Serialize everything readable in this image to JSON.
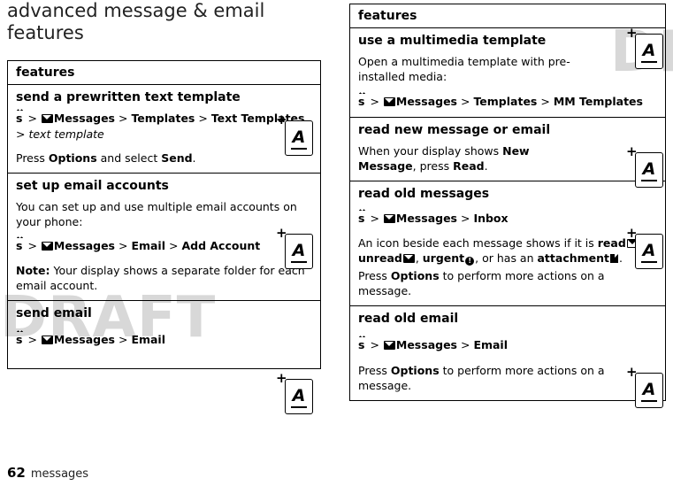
{
  "document": {
    "chapter_title": "advanced message & email features",
    "watermark": "DRAFT",
    "footer": {
      "page_number": "62",
      "section": "messages"
    }
  },
  "left_table": {
    "header": "features",
    "rows": [
      {
        "name": "send a prewritten text template",
        "nav_prefix": "s",
        "nav_path": " > ✉ Messages > Templates > Text Templates > text template",
        "nav_parts": [
          "Messages",
          "Templates",
          "Text Templates"
        ],
        "nav_italic": "text template",
        "note_pre": "Press ",
        "note_bold1": "Options",
        "note_mid": " and select ",
        "note_bold2": "Send",
        "note_end": "."
      },
      {
        "name": "set up email accounts",
        "body": "You can set up and use multiple email accounts on your phone:",
        "nav_parts": [
          "Messages",
          "Email",
          "Add Account"
        ],
        "note_label": "Note:",
        "note_text": " Your display shows a separate folder for each email account."
      },
      {
        "name": "send email",
        "nav_parts": [
          "Messages",
          "Email"
        ]
      }
    ]
  },
  "right_table": {
    "header": "features",
    "rows": [
      {
        "name": "use a multimedia template",
        "body": "Open a multimedia template with pre-installed media:",
        "nav_parts": [
          "Messages",
          "Templates",
          "MM Templates"
        ]
      },
      {
        "name": "read new message or email",
        "body_pre": "When your display shows ",
        "body_bold1": "New Message",
        "body_mid": ", press ",
        "body_bold2": "Read",
        "body_end": "."
      },
      {
        "name": "read old messages",
        "nav_parts": [
          "Messages",
          "Inbox"
        ],
        "body_pre": "An icon beside each message shows if it is ",
        "icon_read_label": "read",
        "icon_unread_label": "unread",
        "icon_urgent_label": "urgent",
        "icon_attach_label": "attachment",
        "body_join1": ", ",
        "body_join2": ", ",
        "body_join3": ", or has an ",
        "body_end": ".",
        "note_pre": "Press ",
        "note_bold": "Options",
        "note_post": " to perform more actions on a message."
      },
      {
        "name": "read old email",
        "nav_parts": [
          "Messages",
          "Email"
        ],
        "note_pre": "Press ",
        "note_bold": "Options",
        "note_post": " to perform more actions on a message."
      }
    ]
  },
  "tabs": [
    {
      "letter": "A",
      "plus": "+"
    },
    {
      "letter": "A",
      "plus": "+"
    },
    {
      "letter": "A",
      "plus": "+"
    },
    {
      "letter": "A",
      "plus": "+"
    },
    {
      "letter": "A",
      "plus": "+"
    },
    {
      "letter": "A",
      "plus": "+"
    },
    {
      "letter": "A",
      "plus": "+"
    }
  ]
}
